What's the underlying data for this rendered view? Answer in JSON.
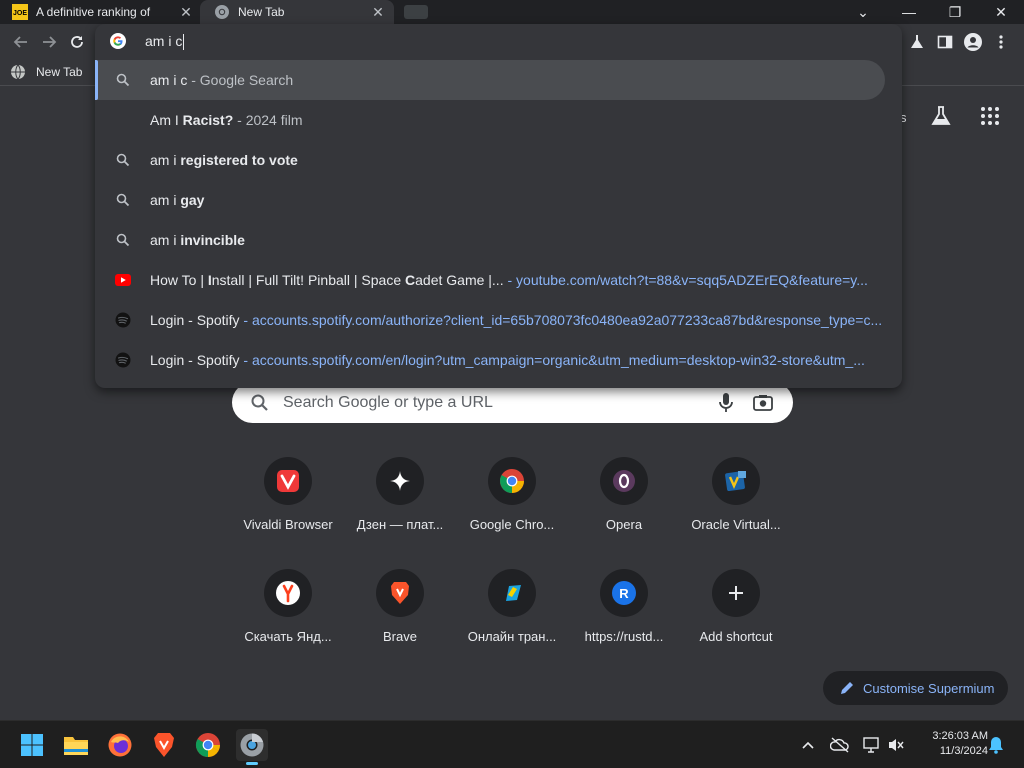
{
  "tabs": [
    {
      "title": "A definitive ranking of",
      "favicon": "joe-icon"
    },
    {
      "title": "New Tab",
      "favicon": "chrome-icon"
    }
  ],
  "window_controls": {
    "chevron": "⌄",
    "minimize": "—",
    "restore": "❐",
    "close": "✕"
  },
  "omnibox": {
    "input_text": "am i c",
    "suggestions": [
      {
        "icon": "search-icon",
        "parts": [
          {
            "t": "am i c",
            "b": false
          }
        ],
        "suffix": " - Google Search",
        "url": ""
      },
      {
        "icon": "",
        "parts": [
          {
            "t": "Am I ",
            "b": false
          },
          {
            "t": "Racist?",
            "b": true
          }
        ],
        "suffix": " - 2024 film",
        "url": ""
      },
      {
        "icon": "search-icon",
        "parts": [
          {
            "t": "am i ",
            "b": false
          },
          {
            "t": "registered to vote",
            "b": true
          }
        ],
        "suffix": "",
        "url": ""
      },
      {
        "icon": "search-icon",
        "parts": [
          {
            "t": "am i ",
            "b": false
          },
          {
            "t": "gay",
            "b": true
          }
        ],
        "suffix": "",
        "url": ""
      },
      {
        "icon": "search-icon",
        "parts": [
          {
            "t": "am i ",
            "b": false
          },
          {
            "t": "invincible",
            "b": true
          }
        ],
        "suffix": "",
        "url": ""
      },
      {
        "icon": "youtube-icon",
        "parts": [
          {
            "t": "How To | ",
            "b": false
          },
          {
            "t": "I",
            "b": true
          },
          {
            "t": "nstall | Full Tilt! Pinball | Space ",
            "b": false
          },
          {
            "t": "C",
            "b": true
          },
          {
            "t": "adet Game |...",
            "b": false
          }
        ],
        "suffix": "",
        "url": "- youtube.com/watch?t=88&v=sqq5ADZErEQ&feature=y..."
      },
      {
        "icon": "spotify-icon",
        "parts": [
          {
            "t": "Login - Spotify",
            "b": false
          }
        ],
        "suffix": "",
        "url": "- accounts.spotify.com/authorize?client_id=65b708073fc0480ea92a077233ca87bd&response_type=c..."
      },
      {
        "icon": "spotify-icon",
        "parts": [
          {
            "t": "Login - Spotify",
            "b": false
          }
        ],
        "suffix": "",
        "url": "- accounts.spotify.com/en/login?utm_campaign=organic&utm_medium=desktop-win32-store&utm_..."
      }
    ]
  },
  "bookmarks": [
    {
      "label": "New Tab"
    }
  ],
  "header_partial": "s",
  "search": {
    "placeholder": "Search Google or type a URL"
  },
  "shortcuts": [
    {
      "label": "Vivaldi Browser",
      "icon": "vivaldi-icon"
    },
    {
      "label": "Дзен — плат...",
      "icon": "dzen-icon"
    },
    {
      "label": "Google Chro...",
      "icon": "chrome-icon"
    },
    {
      "label": "Opera",
      "icon": "opera-icon"
    },
    {
      "label": "Oracle Virtual...",
      "icon": "virtualbox-icon"
    },
    {
      "label": "Скачать Янд...",
      "icon": "yandex-icon"
    },
    {
      "label": "Brave",
      "icon": "brave-icon"
    },
    {
      "label": "Онлайн тран...",
      "icon": "online-icon"
    },
    {
      "label": "https://rustd...",
      "icon": "letter-r-icon",
      "letter": "R"
    },
    {
      "label": "Add shortcut",
      "icon": "plus-icon"
    }
  ],
  "customise": {
    "label": "Customise Supermium"
  },
  "clock": {
    "time": "3:26:03 AM",
    "date": "11/3/2024"
  },
  "colors": {
    "accent": "#8ab4f8",
    "background": "#35363a",
    "dropdown_selected": "#4a4c50"
  }
}
